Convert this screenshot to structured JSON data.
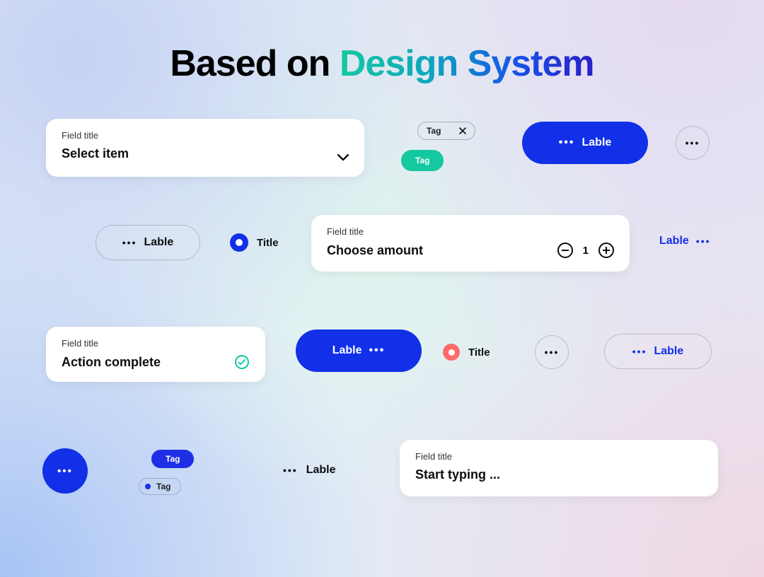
{
  "heading": {
    "plain": "Based on ",
    "highlight": "Design System"
  },
  "labels": {
    "field_title": "Field title",
    "lable": "Lable",
    "title": "Title"
  },
  "tags": {
    "tag": "Tag"
  },
  "fields": {
    "select": {
      "value": "Select item"
    },
    "amount": {
      "value": "Choose amount",
      "qty": "1"
    },
    "action": {
      "value": "Action complete"
    },
    "typing": {
      "placeholder": "Start typing ..."
    }
  },
  "colors": {
    "blue": "#1230e8",
    "teal": "#14c9a0",
    "coral": "#ff6a6a"
  }
}
